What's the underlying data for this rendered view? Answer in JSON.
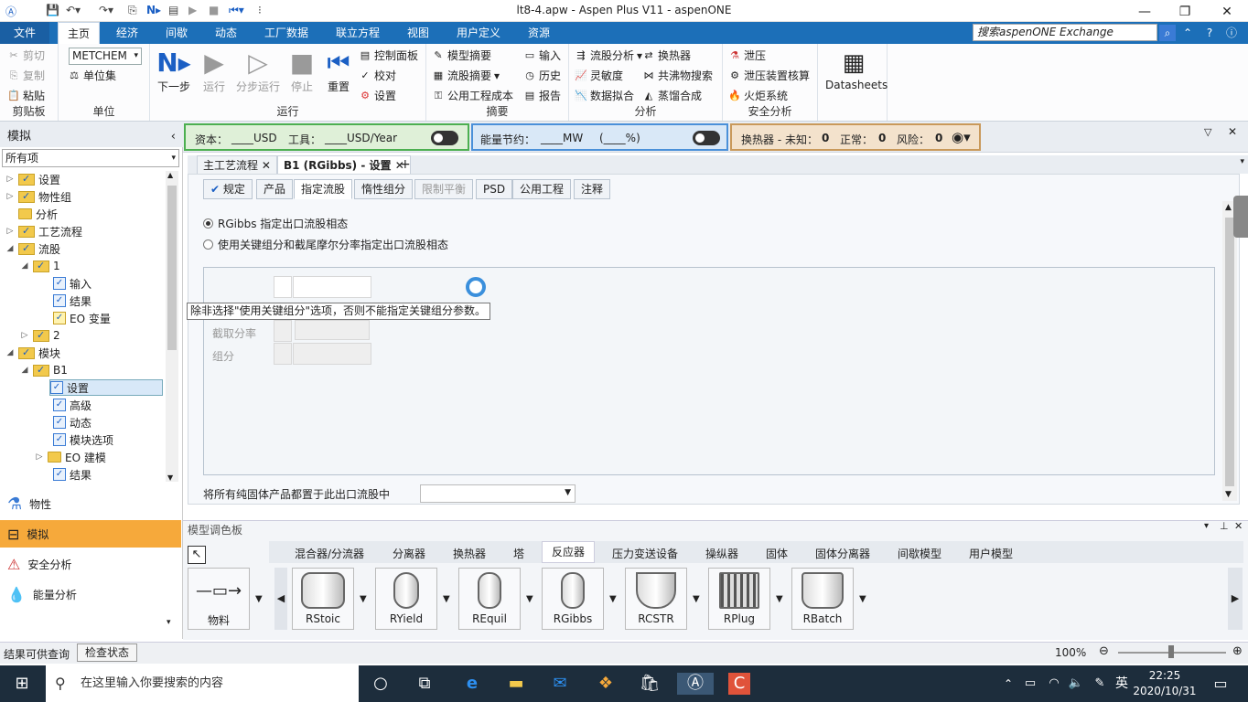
{
  "titlebar": {
    "title": "lt8-4.apw - Aspen Plus V11 - aspenONE"
  },
  "menu": {
    "file": "文件",
    "items": [
      "主页",
      "经济",
      "间歇",
      "动态",
      "工厂数据",
      "联立方程",
      "视图",
      "用户定义",
      "资源"
    ],
    "search_placeholder": "搜索aspenONE Exchange"
  },
  "ribbon": {
    "clipboard": {
      "label": "剪贴板",
      "cut": "剪切",
      "copy": "复制",
      "paste": "粘贴"
    },
    "units": {
      "label": "单位",
      "unit_set": "METCHEM",
      "unit_set_btn": "单位集"
    },
    "run": {
      "label": "运行",
      "next": "下一步",
      "run": "运行",
      "step": "分步运行",
      "stop": "停止",
      "reset": "重置",
      "control_panel": "控制面板",
      "check": "校对",
      "settings": "设置"
    },
    "summary": {
      "label": "摘要",
      "model_summary": "模型摘要",
      "stream_summary": "流股摘要",
      "utility_cost": "公用工程成本",
      "input": "输入",
      "history": "历史",
      "report": "报告"
    },
    "analysis": {
      "label": "分析",
      "stream_analysis": "流股分析",
      "sensitivity": "灵敏度",
      "data_fit": "数据拟合",
      "heat_exchanger": "换热器",
      "azeotrope": "共沸物搜索",
      "distillation": "蒸馏合成"
    },
    "safety": {
      "label": "安全分析",
      "relief": "泄压",
      "relief_check": "泄压装置核算",
      "flare": "火炬系统"
    },
    "datasheets": "Datasheets"
  },
  "kpi": {
    "capital": "资本：",
    "capital_val": "____USD",
    "utility": "工具：",
    "utility_val": "____USD/Year",
    "energy": "能量节约：",
    "energy_val": "____MW",
    "energy_pct": "(____%)",
    "hx": "换热器 - 未知：",
    "hx_unknown": "0",
    "hx_normal_l": "正常：",
    "hx_normal": "0",
    "hx_risk_l": "风险：",
    "hx_risk": "0"
  },
  "leftpane": {
    "header": "模拟",
    "filter": "所有项",
    "tree": [
      {
        "label": "设置"
      },
      {
        "label": "物性组"
      },
      {
        "label": "分析"
      },
      {
        "label": "工艺流程"
      },
      {
        "label": "流股"
      },
      {
        "label": "1"
      },
      {
        "label": "输入"
      },
      {
        "label": "结果"
      },
      {
        "label": "EO 变量"
      },
      {
        "label": "2"
      },
      {
        "label": "模块"
      },
      {
        "label": "B1"
      },
      {
        "label": "设置"
      },
      {
        "label": "高级"
      },
      {
        "label": "动态"
      },
      {
        "label": "模块选项"
      },
      {
        "label": "EO 建模"
      },
      {
        "label": "结果"
      }
    ],
    "nav": {
      "props": "物性",
      "sim": "模拟",
      "safety": "安全分析",
      "energy": "能量分析"
    }
  },
  "doctabs": [
    "主工艺流程",
    "B1 (RGibbs) - 设置"
  ],
  "form": {
    "tabs": [
      "规定",
      "产品",
      "指定流股",
      "惰性组分",
      "限制平衡",
      "PSD",
      "公用工程",
      "注释"
    ],
    "radio1": "RGibbs 指定出口流股相态",
    "radio2": "使用关键组分和截尾摩尔分率指定出口流股相态",
    "tooltip": "除非选择\"使用关键组分\"选项，否则不能指定关键组分参数。",
    "cutoff_label": "截取分率",
    "component_label": "组分",
    "footer_label": "将所有纯固体产品都置于此出口流股中"
  },
  "palette": {
    "title": "模型调色板",
    "categories": [
      "混合器/分流器",
      "分离器",
      "换热器",
      "塔",
      "反应器",
      "压力变送设备",
      "操纵器",
      "固体",
      "固体分离器",
      "间歇模型",
      "用户模型"
    ],
    "items": [
      "物料",
      "RStoic",
      "RYield",
      "REquil",
      "RGibbs",
      "RCSTR",
      "RPlug",
      "RBatch"
    ]
  },
  "status": {
    "left": "结果可供查询",
    "check": "检查状态",
    "zoom": "100%"
  },
  "taskbar": {
    "search": "在这里输入你要搜索的内容",
    "ime": "英",
    "time": "22:25",
    "date": "2020/10/31"
  }
}
